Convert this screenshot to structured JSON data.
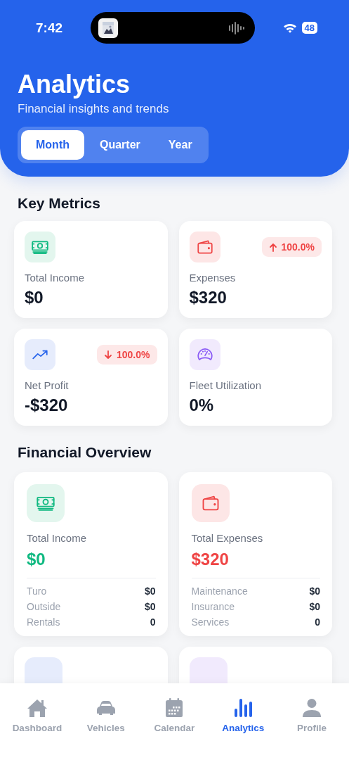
{
  "status_bar": {
    "time": "7:42",
    "battery": "48"
  },
  "header": {
    "title": "Analytics",
    "subtitle": "Financial insights and trends"
  },
  "periods": [
    {
      "label": "Month",
      "selected": true
    },
    {
      "label": "Quarter",
      "selected": false
    },
    {
      "label": "Year",
      "selected": false
    }
  ],
  "key_metrics": {
    "title": "Key Metrics",
    "cards": [
      {
        "kind": "income",
        "label": "Total Income",
        "value": "$0"
      },
      {
        "kind": "expenses",
        "label": "Expenses",
        "value": "$320",
        "badge": {
          "kind": "up",
          "text": "100.0%"
        }
      },
      {
        "kind": "profit",
        "label": "Net Profit",
        "value": "-$320",
        "badge": {
          "kind": "down",
          "text": "100.0%"
        }
      },
      {
        "kind": "utilization",
        "label": "Fleet Utilization",
        "value": "0%"
      }
    ]
  },
  "financial_overview": {
    "title": "Financial Overview",
    "cards": [
      {
        "kind": "income",
        "label": "Total Income",
        "value": "$0",
        "color": "#10b981",
        "rows": [
          {
            "label": "Turo",
            "value": "$0"
          },
          {
            "label": "Outside",
            "value": "$0"
          },
          {
            "label": "Rentals",
            "value": "0"
          }
        ]
      },
      {
        "kind": "expenses",
        "label": "Total Expenses",
        "value": "$320",
        "color": "#ef4444",
        "rows": [
          {
            "label": "Maintenance",
            "value": "$0"
          },
          {
            "label": "Insurance",
            "value": "$0"
          },
          {
            "label": "Services",
            "value": "0"
          }
        ]
      }
    ],
    "partial_cards": [
      {
        "kind": "profit"
      },
      {
        "kind": "utilization"
      }
    ]
  },
  "tab_bar": [
    {
      "kind": "home",
      "label": "Dashboard",
      "selected": false
    },
    {
      "kind": "car",
      "label": "Vehicles",
      "selected": false
    },
    {
      "kind": "calendar",
      "label": "Calendar",
      "selected": false
    },
    {
      "kind": "chart",
      "label": "Analytics",
      "selected": true
    },
    {
      "kind": "person",
      "label": "Profile",
      "selected": false
    }
  ]
}
